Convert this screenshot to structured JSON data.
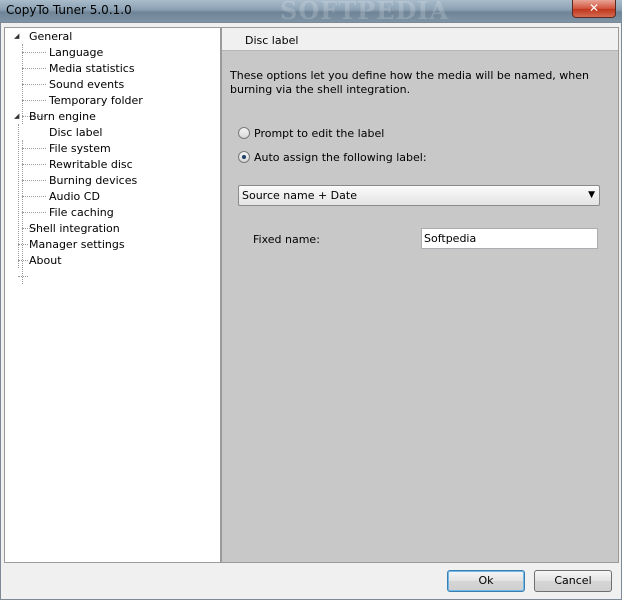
{
  "window": {
    "title": "CopyTo Tuner 5.0.1.0",
    "close_label": "✕",
    "watermark": "SOFTPEDIA"
  },
  "tree": {
    "items": [
      {
        "label": "General",
        "level": 0,
        "expanded": true
      },
      {
        "label": "Language",
        "level": 1
      },
      {
        "label": "Media statistics",
        "level": 1
      },
      {
        "label": "Sound events",
        "level": 1
      },
      {
        "label": "Temporary folder",
        "level": 1
      },
      {
        "label": "Burn engine",
        "level": 0,
        "expanded": true
      },
      {
        "label": "Disc label",
        "level": 1,
        "selected": true
      },
      {
        "label": "File system",
        "level": 1
      },
      {
        "label": "Rewritable disc",
        "level": 1
      },
      {
        "label": "Burning devices",
        "level": 1
      },
      {
        "label": "Audio CD",
        "level": 1
      },
      {
        "label": "File caching",
        "level": 1
      },
      {
        "label": "Shell integration",
        "level": 0
      },
      {
        "label": "Manager settings",
        "level": 0
      },
      {
        "label": "About",
        "level": 0
      }
    ]
  },
  "panel": {
    "header": "Disc label",
    "description": "These options let you define how the media will be named, when burning via the shell integration.",
    "radio_prompt": "Prompt to edit the label",
    "radio_auto": "Auto assign the following label:",
    "selected_radio": "auto",
    "dropdown_value": "Source name + Date",
    "fixed_name_label": "Fixed name:",
    "fixed_name_value": "Softpedia"
  },
  "buttons": {
    "ok": "Ok",
    "cancel": "Cancel"
  }
}
